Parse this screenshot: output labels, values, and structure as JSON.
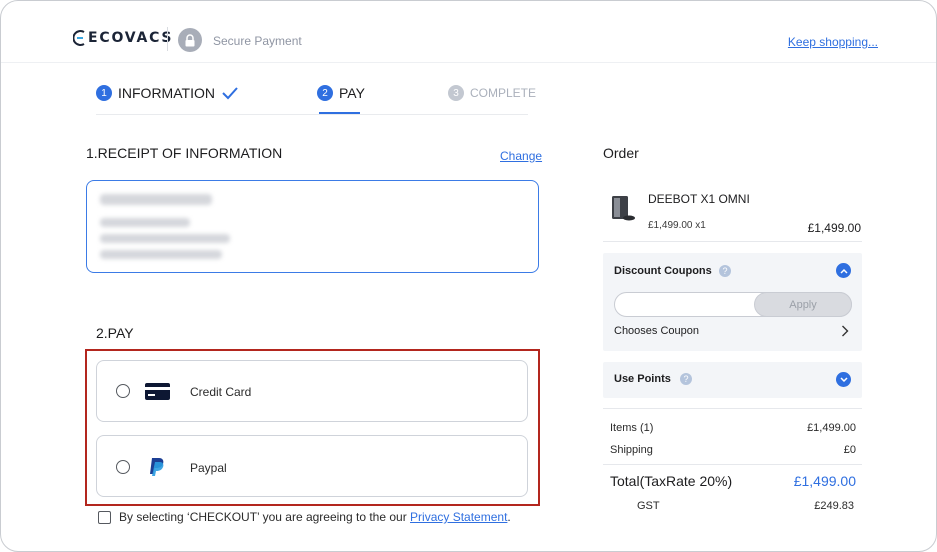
{
  "header": {
    "brand": "ECOVACS",
    "secure_label": "Secure Payment",
    "keep_shopping": "Keep shopping..."
  },
  "steps": [
    {
      "number": "1",
      "label": "INFORMATION",
      "status": "done"
    },
    {
      "number": "2",
      "label": "PAY",
      "status": "active"
    },
    {
      "number": "3",
      "label": "COMPLETE",
      "status": "pending"
    }
  ],
  "receipt": {
    "title": "1.RECEIPT OF INFORMATION",
    "change_label": "Change"
  },
  "pay": {
    "title": "2.PAY",
    "options": [
      {
        "label": "Credit Card",
        "icon": "credit-card-icon"
      },
      {
        "label": "Paypal",
        "icon": "paypal-icon"
      }
    ],
    "agree_prefix": "By selecting ‘CHECKOUT’ you are agreeing to the our ",
    "privacy_label": "Privacy Statement",
    "agree_suffix": "."
  },
  "order": {
    "title": "Order",
    "product": {
      "name": "DEEBOT X1 OMNI",
      "unit": "£1,499.00 x1",
      "total": "£1,499.00"
    },
    "coupons": {
      "title": "Discount Coupons",
      "help": "?",
      "apply_label": "Apply",
      "choose_label": "Chooses Coupon"
    },
    "points": {
      "title": "Use Points",
      "help": "?"
    },
    "summary": {
      "items_label": "Items (1)",
      "items_value": "£1,499.00",
      "shipping_label": "Shipping",
      "shipping_value": "£0",
      "total_label": "Total(TaxRate 20%)",
      "total_value": "£1,499.00",
      "gst_label": "GST",
      "gst_value": "£249.83"
    }
  },
  "colors": {
    "accent": "#2f6fe0",
    "highlight_border": "#b3261e"
  }
}
